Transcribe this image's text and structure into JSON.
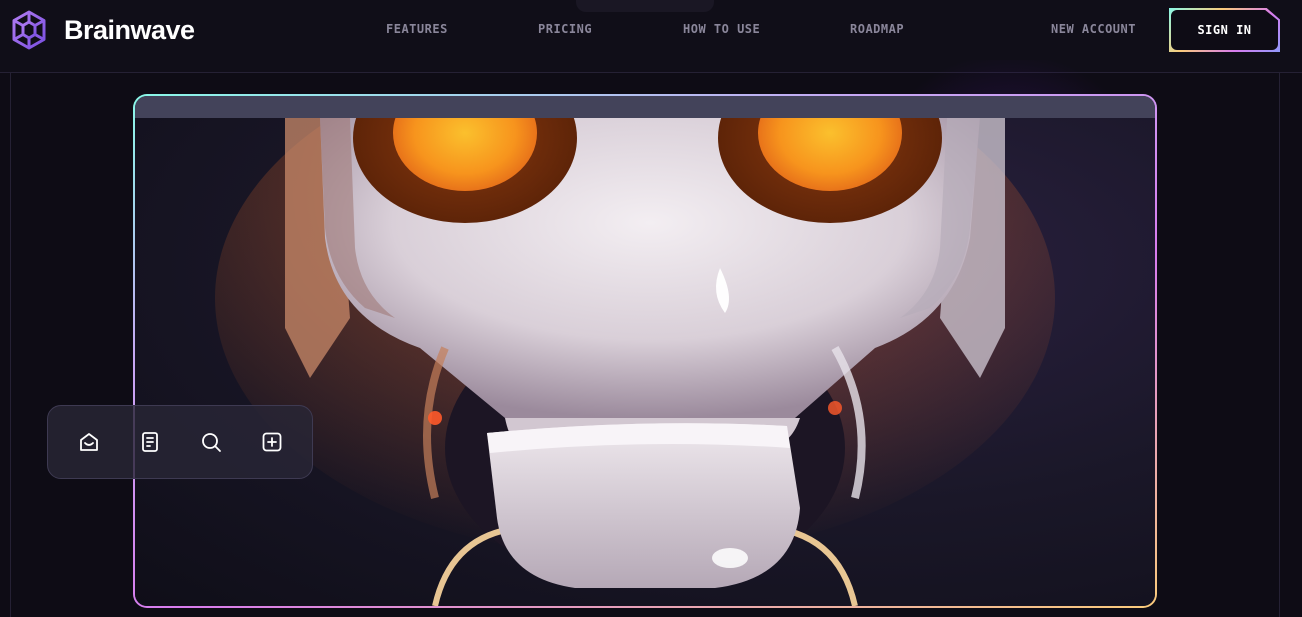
{
  "header": {
    "brand": "Brainwave",
    "nav": [
      "FEATURES",
      "PRICING",
      "HOW TO USE",
      "ROADMAP"
    ],
    "new_account": "NEW ACCOUNT",
    "sign_in": "SIGN IN"
  },
  "hero": {
    "image": "robot-face-illustration",
    "toolbar_icons": [
      "home-icon",
      "document-icon",
      "search-icon",
      "plus-square-icon"
    ]
  },
  "colors": {
    "background": "#0e0c15",
    "nav_text": "#8a869a",
    "accent_teal": "#89f9e8",
    "accent_pink": "#d87cee",
    "accent_yellow": "#facb7b",
    "robot_eye": "#f7a51c"
  }
}
